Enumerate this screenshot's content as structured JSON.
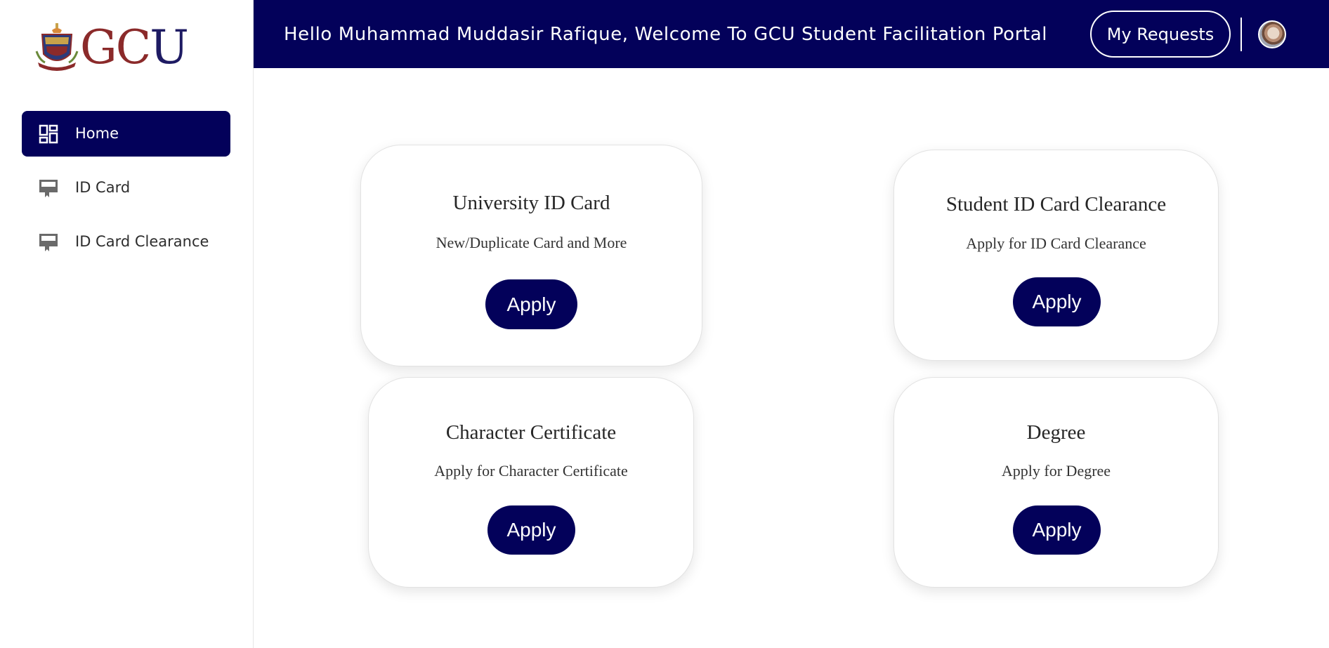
{
  "sidebar": {
    "logo_text": "GCU",
    "items": [
      {
        "label": "Home",
        "icon": "dashboard-icon",
        "active": true
      },
      {
        "label": "ID Card",
        "icon": "id-card-icon",
        "active": false
      },
      {
        "label": "ID Card Clearance",
        "icon": "id-card-clearance-icon",
        "active": false
      }
    ]
  },
  "header": {
    "welcome": "Hello Muhammad Muddasir Rafique, Welcome To GCU Student Facilitation Portal",
    "my_requests": "My Requests",
    "avatar_icon": "user-avatar"
  },
  "cards": [
    {
      "title": "University ID Card",
      "subtitle": "New/Duplicate Card and More",
      "button": "Apply"
    },
    {
      "title": "Student ID Card Clearance",
      "subtitle": "Apply for ID Card Clearance",
      "button": "Apply"
    },
    {
      "title": "Character Certificate",
      "subtitle": "Apply for Character Certificate",
      "button": "Apply"
    },
    {
      "title": "Degree",
      "subtitle": "Apply for Degree",
      "button": "Apply"
    }
  ],
  "colors": {
    "primary": "#03015a",
    "logo_red": "#8b2a2a",
    "logo_blue": "#1e1b63"
  }
}
